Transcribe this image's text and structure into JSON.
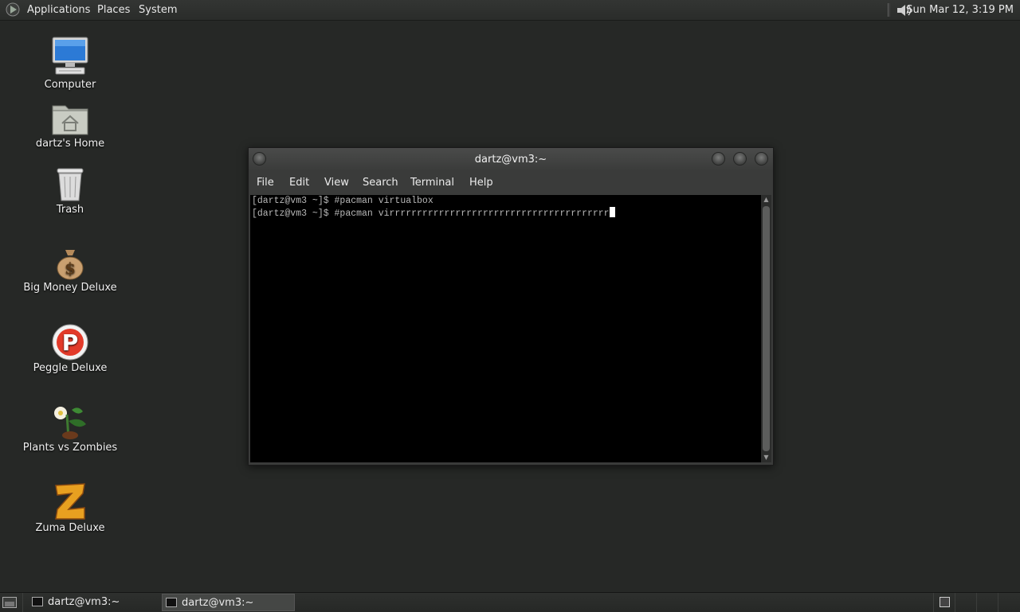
{
  "top_panel": {
    "menus": [
      "Applications",
      "Places",
      "System"
    ],
    "clock": "Sun Mar 12,  3:19 PM"
  },
  "desktop": {
    "icons": [
      {
        "label": "Computer",
        "icon": "computer-icon"
      },
      {
        "label": "dartz's Home",
        "icon": "home-folder-icon"
      },
      {
        "label": "Trash",
        "icon": "trash-icon"
      },
      {
        "label": "Big Money Deluxe",
        "icon": "money-bag-icon"
      },
      {
        "label": "Peggle Deluxe",
        "icon": "peggle-icon"
      },
      {
        "label": "Plants vs Zombies",
        "icon": "plants-vs-zombies-icon"
      },
      {
        "label": "Zuma Deluxe",
        "icon": "zuma-icon"
      }
    ]
  },
  "terminal": {
    "title": "dartz@vm3:~",
    "menu": [
      "File",
      "Edit",
      "View",
      "Search",
      "Terminal",
      "Help"
    ],
    "lines": [
      "[dartz@vm3 ~]$ #pacman virtualbox",
      "[dartz@vm3 ~]$ #pacman virrrrrrrrrrrrrrrrrrrrrrrrrrrrrrrrrrrrrrrr"
    ]
  },
  "taskbar": {
    "tasks": [
      {
        "label": "dartz@vm3:~",
        "active": false
      },
      {
        "label": "dartz@vm3:~",
        "active": true
      }
    ]
  },
  "colors": {
    "desktop_bg": "#262826",
    "terminal_bg": "#000000",
    "terminal_fg": "#b8b8b8"
  }
}
